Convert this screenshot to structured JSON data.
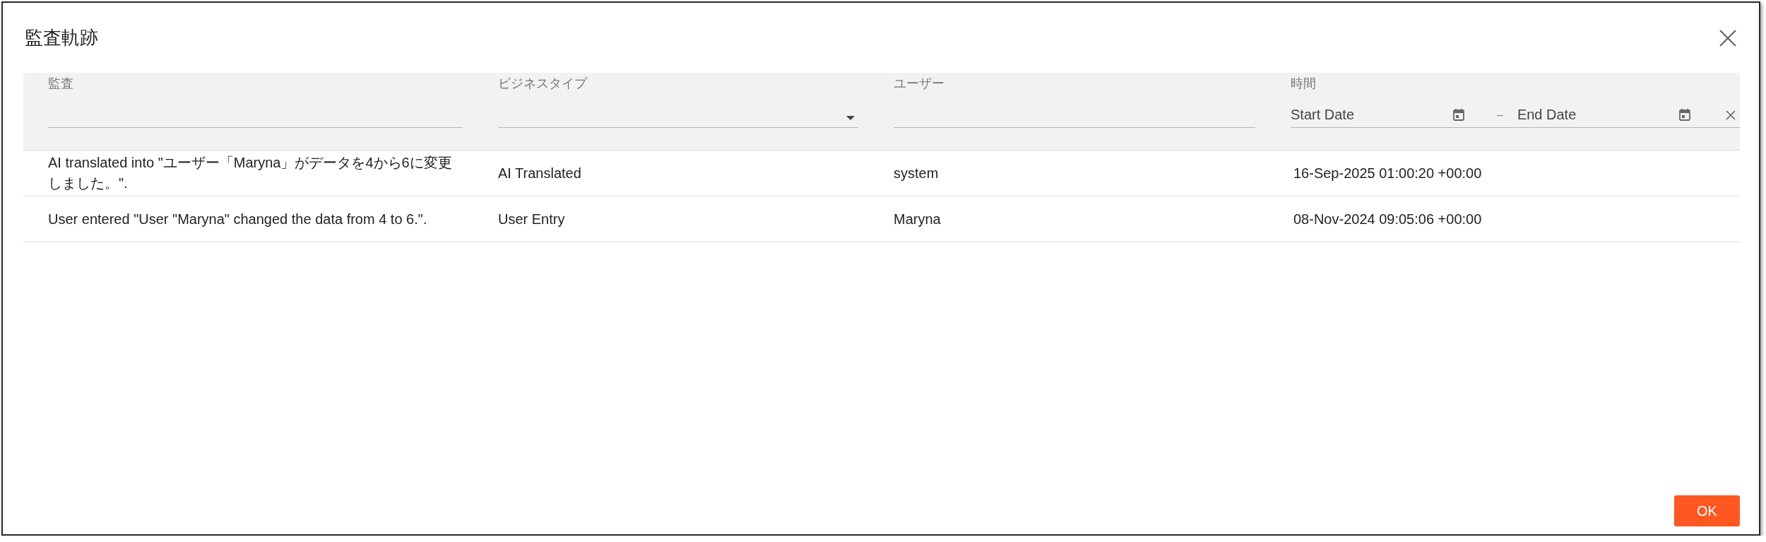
{
  "dialog": {
    "title": "監査軌跡"
  },
  "table": {
    "columns": [
      {
        "label": "監査",
        "filter": {
          "kind": "text"
        }
      },
      {
        "label": "ビジネスタイプ",
        "filter": {
          "kind": "select"
        }
      },
      {
        "label": "ユーザー",
        "filter": {
          "kind": "text"
        }
      },
      {
        "label": "時間",
        "filter": {
          "kind": "daterange",
          "start_placeholder": "Start Date",
          "separator": "–",
          "end_placeholder": "End Date"
        }
      }
    ],
    "rows": [
      {
        "cells": [
          "AI translated into \"ユーザー「Maryna」がデータを4から6に変更しました。\".",
          "AI Translated",
          "system",
          "16-Sep-2025 01:00:20 +00:00"
        ]
      },
      {
        "cells": [
          "User entered \"User \"Maryna\" changed the data from 4 to 6.\".",
          "User Entry",
          "Maryna",
          "08-Nov-2024 09:05:06 +00:00"
        ]
      }
    ]
  },
  "buttons": [
    {
      "label": "OK",
      "kind": "primary"
    }
  ]
}
